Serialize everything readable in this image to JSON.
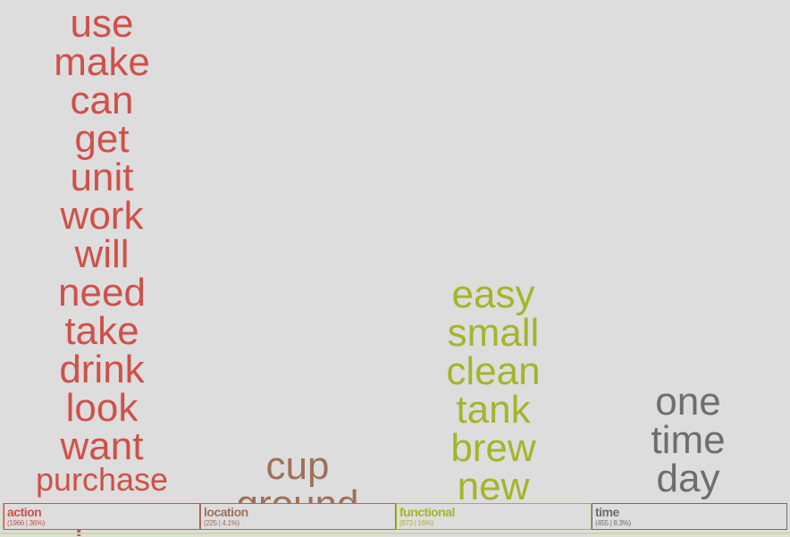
{
  "chart_data": {
    "type": "word-cloud-columns",
    "categories": [
      {
        "name": "action",
        "count": "1966",
        "percent": "36%",
        "color": "#d0504a",
        "words": [
          "use",
          "make",
          "can",
          "get",
          "unit",
          "work",
          "will",
          "need",
          "take",
          "drink",
          "look",
          "want",
          "purchase",
          "put"
        ]
      },
      {
        "name": "location",
        "count": "225",
        "percent": "4.1%",
        "color": "#a0705a",
        "words": [
          "cup",
          "ground"
        ]
      },
      {
        "name": "functional",
        "count": "873",
        "percent": "16%",
        "color": "#a4b52a",
        "words": [
          "easy",
          "small",
          "clean",
          "tank",
          "brew",
          "new"
        ]
      },
      {
        "name": "time",
        "count": "455",
        "percent": "8.3%",
        "color": "#6e6e6e",
        "words": [
          "one",
          "time",
          "day"
        ]
      }
    ]
  }
}
